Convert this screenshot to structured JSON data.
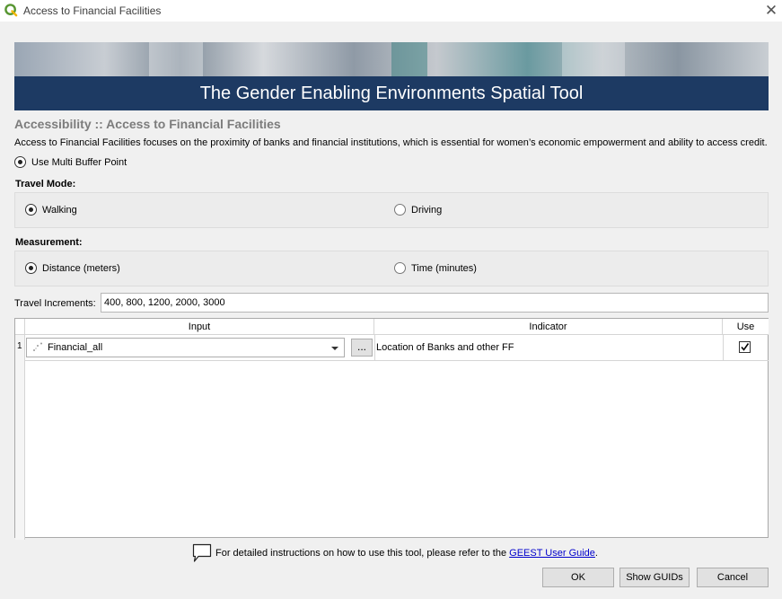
{
  "window": {
    "title": "Access to Financial Facilities",
    "close_glyph": "✕"
  },
  "banner": {
    "title": "The Gender Enabling Environments Spatial Tool"
  },
  "heading": "Accessibility :: Access to Financial Facilities",
  "description": "Access to Financial Facilities focuses on the proximity of banks and financial institutions, which is essential for women’s economic empowerment and ability to access credit.",
  "multi_buffer": {
    "label": "Use Multi Buffer Point",
    "selected": true
  },
  "travel_mode": {
    "label": "Travel Mode:",
    "options": [
      {
        "label": "Walking",
        "selected": true
      },
      {
        "label": "Driving",
        "selected": false
      }
    ]
  },
  "measurement": {
    "label": "Measurement:",
    "options": [
      {
        "label": "Distance (meters)",
        "selected": true
      },
      {
        "label": "Time (minutes)",
        "selected": false
      }
    ]
  },
  "travel_increments": {
    "label": "Travel Increments:",
    "value": "400, 800, 1200, 2000, 3000"
  },
  "table": {
    "headers": [
      "Input",
      "Indicator",
      "Use"
    ],
    "rows": [
      {
        "number": "1",
        "input": "Financial_all",
        "browse_label": "...",
        "indicator": "Location of Banks and other FF",
        "use": true
      }
    ]
  },
  "footer": {
    "text_before": "For detailed instructions on how to use this tool, please refer to the ",
    "link": "GEEST User Guide",
    "text_after": "."
  },
  "buttons": {
    "ok": "OK",
    "show_guids": "Show GUIDs",
    "cancel": "Cancel"
  },
  "colors": {
    "banner_band": "#1d3a63",
    "heading": "#7c7c7c",
    "link": "#0000cc"
  },
  "icons": {
    "app": "qgis-icon",
    "close": "close-icon",
    "point_layer": "point-layer-icon",
    "help": "speech-bubble-icon"
  }
}
